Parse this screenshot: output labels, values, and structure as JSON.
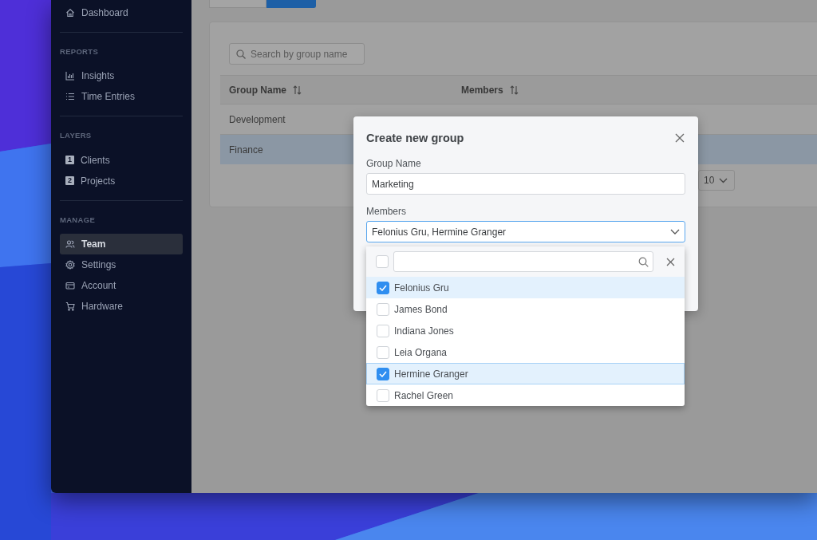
{
  "sidebar": {
    "sections": [
      {
        "items": [
          {
            "label": "Dashboard",
            "selected": false
          }
        ]
      },
      {
        "heading": "REPORTS",
        "items": [
          {
            "label": "Insights",
            "selected": false
          },
          {
            "label": "Time Entries",
            "selected": false
          }
        ]
      },
      {
        "heading": "LAYERS",
        "items": [
          {
            "label": "Clients",
            "badge": "1",
            "selected": false
          },
          {
            "label": "Projects",
            "badge": "2",
            "selected": false
          }
        ]
      },
      {
        "heading": "MANAGE",
        "items": [
          {
            "label": "Team",
            "selected": true
          },
          {
            "label": "Settings",
            "selected": false
          },
          {
            "label": "Account",
            "selected": false
          },
          {
            "label": "Hardware",
            "selected": false
          }
        ]
      }
    ]
  },
  "tabs": [
    {
      "selected": false
    },
    {
      "selected": true
    }
  ],
  "search": {
    "placeholder": "Search by group name"
  },
  "table": {
    "columns": [
      "Group Name",
      "Members"
    ],
    "rows": [
      {
        "cells": [
          "Development"
        ],
        "selected": false
      },
      {
        "cells": [
          "Finance"
        ],
        "selected": true
      }
    ]
  },
  "page_size": "10",
  "modal": {
    "title": "Create new group",
    "fields": [
      {
        "kind": "input",
        "label": "Group Name",
        "value": "Marketing"
      },
      {
        "kind": "select",
        "label": "Members",
        "value": "Felonius Gru, Hermine Granger",
        "expanded": true
      }
    ],
    "dropdown": {
      "select_all": {
        "checked": false
      },
      "items": [
        {
          "label": "Felonius Gru",
          "checked": true,
          "focused": false
        },
        {
          "label": "James Bond",
          "checked": false,
          "focused": false
        },
        {
          "label": "Indiana Jones",
          "checked": false,
          "focused": false
        },
        {
          "label": "Leia Organa",
          "checked": false,
          "focused": false
        },
        {
          "label": "Hermine Granger",
          "checked": true,
          "focused": true
        },
        {
          "label": "Rachel Green",
          "checked": false,
          "focused": false
        }
      ]
    }
  }
}
